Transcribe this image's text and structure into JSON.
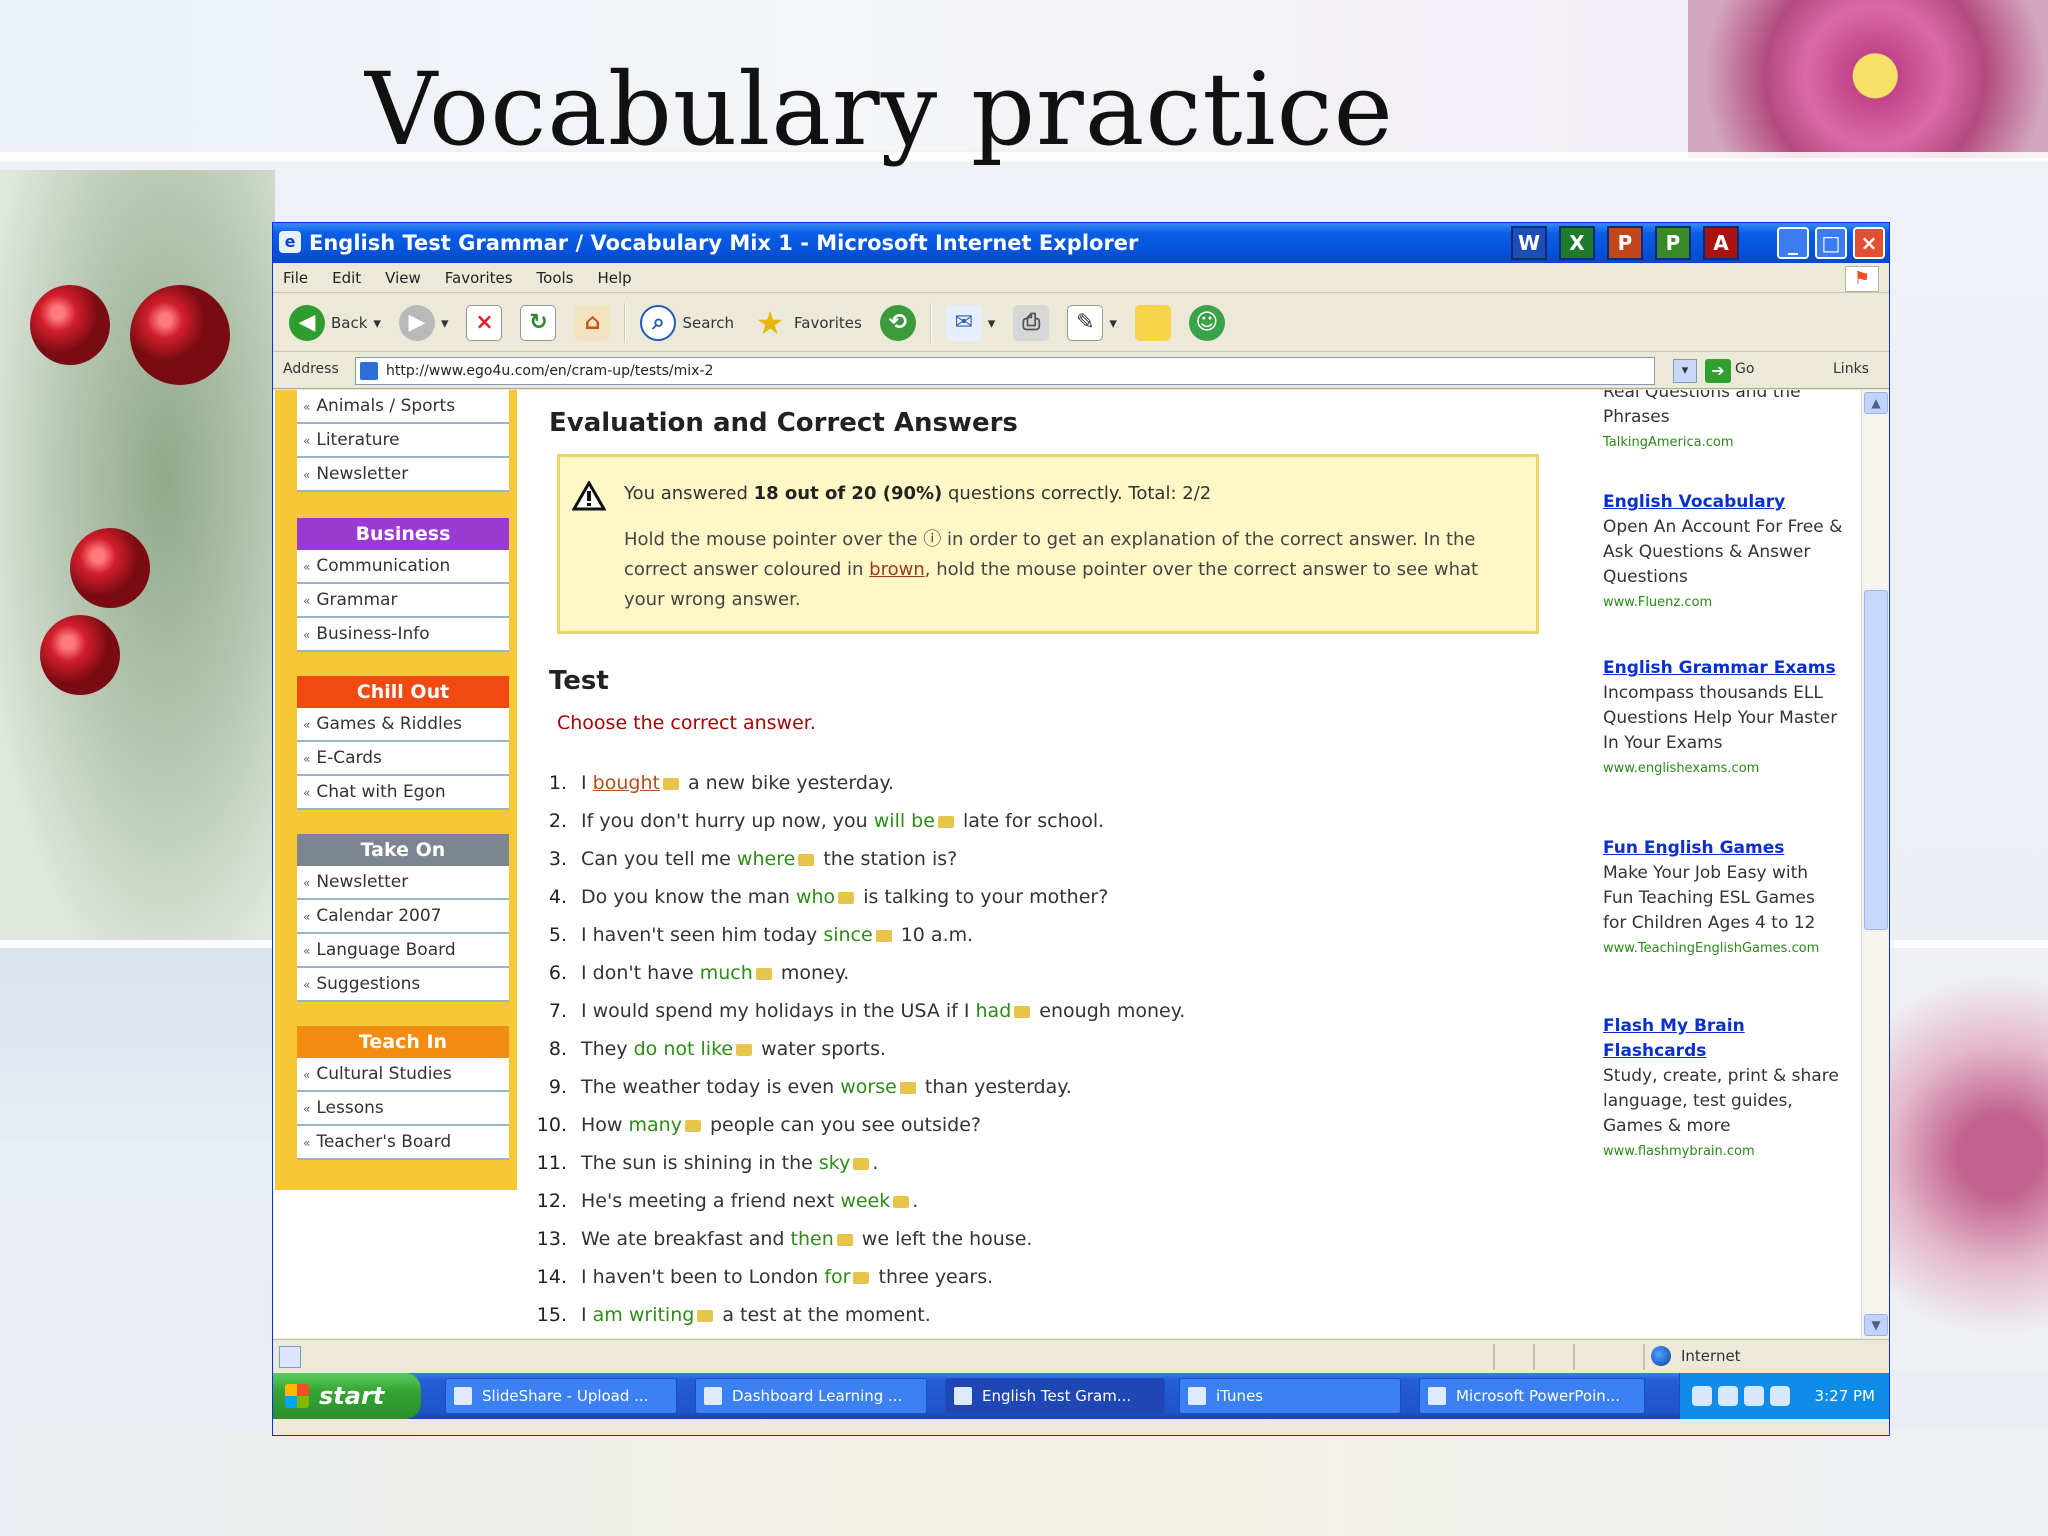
{
  "slide": {
    "title": "Vocabulary practice"
  },
  "window": {
    "title": "English Test Grammar / Vocabulary Mix 1 - Microsoft Internet Explorer",
    "app_icons": [
      {
        "name": "word-icon",
        "glyph": "W",
        "color": "#1b4fb5"
      },
      {
        "name": "excel-icon",
        "glyph": "X",
        "color": "#1f7a2c"
      },
      {
        "name": "powerpoint-icon",
        "glyph": "P",
        "color": "#c2461b"
      },
      {
        "name": "publisher-icon",
        "glyph": "P",
        "color": "#3a8a2a"
      },
      {
        "name": "acrobat-icon",
        "glyph": "A",
        "color": "#a11"
      }
    ],
    "controls": {
      "minimize": "_",
      "maximize": "□",
      "close": "×"
    }
  },
  "menu": [
    "File",
    "Edit",
    "View",
    "Favorites",
    "Tools",
    "Help"
  ],
  "toolbar": {
    "back": "Back",
    "search": "Search",
    "favorites": "Favorites",
    "stop_glyph": "×",
    "refresh_glyph": "↻",
    "home_glyph": "⌂"
  },
  "address": {
    "label": "Address",
    "url": "http://www.ego4u.com/en/cram-up/tests/mix-2",
    "go": "Go",
    "links": "Links"
  },
  "nav": {
    "sections": [
      {
        "items": [
          "Animals / Sports",
          "Literature",
          "Newsletter"
        ]
      },
      {
        "title": "Business",
        "color": "#9b3ad0",
        "items": [
          "Communication",
          "Grammar",
          "Business-Info"
        ]
      },
      {
        "title": "Chill Out",
        "color": "#f04a12",
        "items": [
          "Games & Riddles",
          "E-Cards",
          "Chat with Egon"
        ]
      },
      {
        "title": "Take On",
        "color": "#7d8590",
        "items": [
          "Newsletter",
          "Calendar 2007",
          "Language Board",
          "Suggestions"
        ]
      },
      {
        "title": "Teach In",
        "color": "#f28c12",
        "items": [
          "Cultural Studies",
          "Lessons",
          "Teacher's Board"
        ]
      }
    ]
  },
  "main": {
    "heading": "Evaluation and Correct Answers",
    "notice": {
      "score_pre": "You answered ",
      "score": "18 out of 20 (90%)",
      "score_post": " questions correctly. Total: 2/2",
      "para_1": "Hold the mouse pointer over the ⓘ in order to get an explanation of the correct answer. In the correct answer coloured in ",
      "brown": "brown",
      "para_2": ", hold the mouse pointer over the correct answer to see what your wrong answer."
    },
    "test_heading": "Test",
    "instruction": "Choose the correct answer.",
    "questions": [
      {
        "n": "1.",
        "pre": "I ",
        "ans": "bought",
        "wrong": true,
        "post": " a new bike yesterday."
      },
      {
        "n": "2.",
        "pre": "If you don't hurry up now, you ",
        "ans": "will be",
        "wrong": false,
        "post": " late for school."
      },
      {
        "n": "3.",
        "pre": "Can you tell me ",
        "ans": "where",
        "wrong": false,
        "post": " the station is?"
      },
      {
        "n": "4.",
        "pre": "Do you know the man ",
        "ans": "who",
        "wrong": false,
        "post": " is talking to your mother?"
      },
      {
        "n": "5.",
        "pre": "I haven't seen him today ",
        "ans": "since",
        "wrong": false,
        "post": " 10 a.m."
      },
      {
        "n": "6.",
        "pre": "I don't have ",
        "ans": "much",
        "wrong": false,
        "post": " money."
      },
      {
        "n": "7.",
        "pre": "I would spend my holidays in the USA if I ",
        "ans": "had",
        "wrong": false,
        "post": " enough money."
      },
      {
        "n": "8.",
        "pre": "They ",
        "ans": "do not like",
        "wrong": false,
        "post": " water sports."
      },
      {
        "n": "9.",
        "pre": "The weather today is even ",
        "ans": "worse",
        "wrong": false,
        "post": " than yesterday."
      },
      {
        "n": "10.",
        "pre": "How ",
        "ans": "many",
        "wrong": false,
        "post": " people can you see outside?"
      },
      {
        "n": "11.",
        "pre": "The sun is shining in the ",
        "ans": "sky",
        "wrong": false,
        "post": "."
      },
      {
        "n": "12.",
        "pre": "He's meeting a friend next ",
        "ans": "week",
        "wrong": false,
        "post": "."
      },
      {
        "n": "13.",
        "pre": "We ate breakfast and ",
        "ans": "then",
        "wrong": false,
        "post": " we left the house."
      },
      {
        "n": "14.",
        "pre": "I haven't been to London ",
        "ans": "for",
        "wrong": false,
        "post": " three years."
      },
      {
        "n": "15.",
        "pre": "I ",
        "ans": "am writing",
        "wrong": false,
        "post": " a test at the moment."
      }
    ]
  },
  "ads": [
    {
      "title": "",
      "body": "Real Questions and the Phrases",
      "url": "TalkingAmerica.com"
    },
    {
      "title": "English Vocabulary",
      "body": "Open An Account For Free & Ask Questions & Answer Questions",
      "url": "www.Fluenz.com"
    },
    {
      "title": "English Grammar Exams",
      "body": "Incompass thousands ELL Questions Help Your Master In Your Exams",
      "url": "www.englishexams.com"
    },
    {
      "title": "Fun English Games",
      "body": "Make Your Job Easy with Fun Teaching ESL Games for Children Ages 4 to 12",
      "url": "www.TeachingEnglishGames.com"
    },
    {
      "title": "Flash My Brain Flashcards",
      "body": "Study, create, print & share language, test guides, Games & more",
      "url": "www.flashmybrain.com"
    }
  ],
  "status": {
    "zone": "Internet"
  },
  "taskbar": {
    "start": "start",
    "tasks": [
      "SlideShare - Upload ...",
      "Dashboard Learning ...",
      "English Test Gram...",
      "iTunes",
      "Microsoft PowerPoin..."
    ],
    "clock": "3:27 PM"
  }
}
